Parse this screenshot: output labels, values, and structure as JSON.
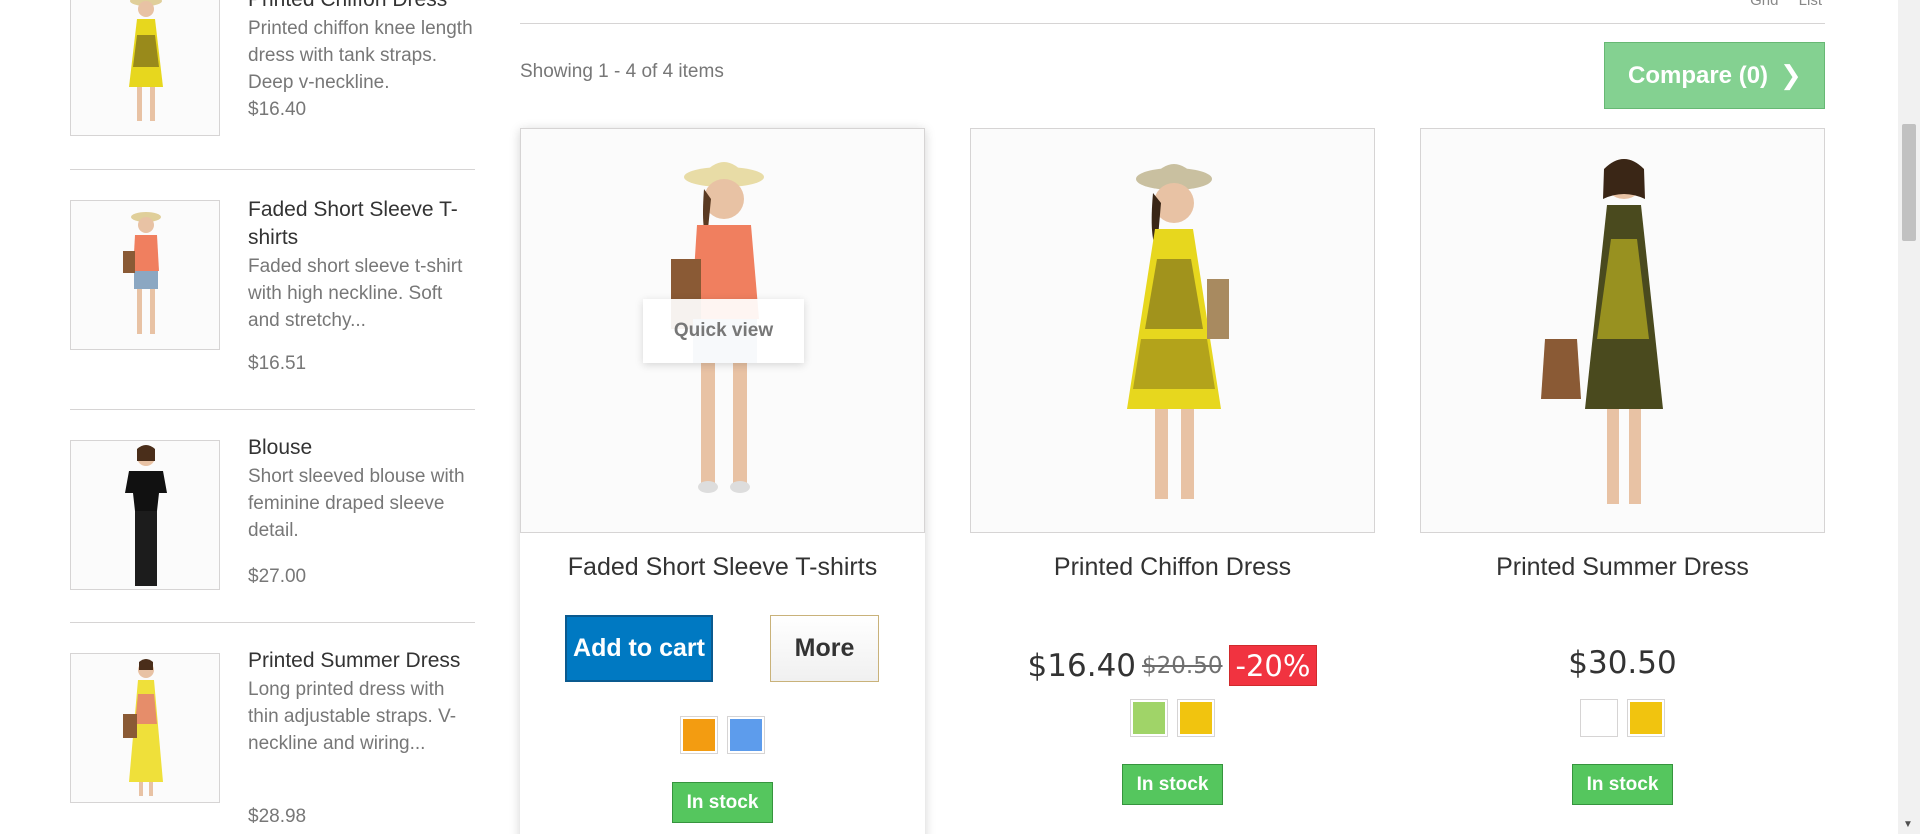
{
  "view_links": [
    "Grid",
    "List"
  ],
  "sidebar": {
    "items": [
      {
        "name": "Printed Chiffon Dress",
        "desc": "Printed chiffon knee length dress with tank straps. Deep v-neckline.",
        "price": "$16.40"
      },
      {
        "name": "Faded Short Sleeve T-shirts",
        "desc": "Faded short sleeve t-shirt with high neckline. Soft and stretchy...",
        "price": "$16.51"
      },
      {
        "name": "Blouse",
        "desc": "Short sleeved blouse with feminine draped sleeve detail.",
        "price": "$27.00"
      },
      {
        "name": "Printed Summer Dress",
        "desc": "Long printed dress with thin adjustable straps. V-neckline and wiring...",
        "price": "$28.98"
      }
    ]
  },
  "listing": {
    "showing": "Showing 1 - 4 of 4 items",
    "compare_label": "Compare (0)"
  },
  "products": [
    {
      "name": "Faded Short Sleeve T-shirts",
      "quick_view": "Quick view",
      "add_to_cart": "Add to cart",
      "more": "More",
      "colors": [
        "#f39c11",
        "#5d9cec"
      ],
      "stock": "In stock"
    },
    {
      "name": "Printed Chiffon Dress",
      "price": "$16.40",
      "old_price": "$20.50",
      "discount": "-20%",
      "colors": [
        "#a0d468",
        "#f1c40f"
      ],
      "stock": "In stock"
    },
    {
      "name": "Printed Summer Dress",
      "price": "$30.50",
      "colors": [
        "#ffffff",
        "#f1c40f"
      ],
      "stock": "In stock"
    }
  ],
  "colors": {
    "accent_blue": "#0079c2",
    "stock_green": "#55c65e",
    "compare_green": "#7ecf8c",
    "discount_red": "#f13340"
  }
}
